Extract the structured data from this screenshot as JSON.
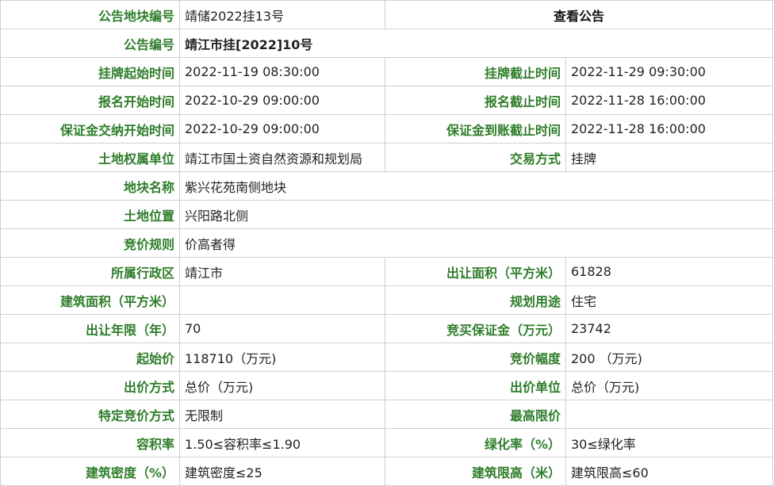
{
  "labels": {
    "block_no": "公告地块编号",
    "notice_no": "公告编号",
    "listing_start": "挂牌起始时间",
    "listing_end": "挂牌截止时间",
    "reg_start": "报名开始时间",
    "reg_end": "报名截止时间",
    "deposit_start": "保证金交纳开始时间",
    "deposit_end": "保证金到账截止时间",
    "owner": "土地权属单位",
    "trade_mode": "交易方式",
    "parcel_name": "地块名称",
    "location": "土地位置",
    "bid_rule": "竞价规则",
    "district": "所属行政区",
    "area": "出让面积（平方米）",
    "building_area": "建筑面积（平方米）",
    "usage": "规划用途",
    "term": "出让年限（年）",
    "bid_deposit": "竞买保证金（万元）",
    "start_price": "起始价",
    "increment": "竞价幅度",
    "bid_mode": "出价方式",
    "bid_unit": "出价单位",
    "special_mode": "特定竞价方式",
    "max_price": "最高限价",
    "far": "容积率",
    "green": "绿化率（%）",
    "density": "建筑密度（%）",
    "height": "建筑限高（米）"
  },
  "values": {
    "block_no": "靖储2022挂13号",
    "view_notice": "查看公告",
    "notice_no": "靖江市挂[2022]10号",
    "listing_start": "2022-11-19 08:30:00",
    "listing_end": "2022-11-29 09:30:00",
    "reg_start": "2022-10-29 09:00:00",
    "reg_end": "2022-11-28 16:00:00",
    "deposit_start": "2022-10-29 09:00:00",
    "deposit_end": "2022-11-28 16:00:00",
    "owner": "靖江市国土资自然资源和规划局",
    "trade_mode": "挂牌",
    "parcel_name": "紫兴花苑南侧地块",
    "location": "兴阳路北侧",
    "bid_rule": "价高者得",
    "district": "靖江市",
    "area": "61828",
    "building_area": "",
    "usage": "住宅",
    "term": "70",
    "bid_deposit": "23742",
    "start_price": "118710（万元)",
    "increment": "200 （万元)",
    "bid_mode": "总价（万元)",
    "bid_unit": "总价（万元)",
    "special_mode": "无限制",
    "max_price": "",
    "far": "1.50≤容积率≤1.90",
    "green": "30≤绿化率",
    "density": "建筑密度≤25",
    "height": "建筑限高≤60"
  },
  "colors": {
    "label_green": "#2e7d2a",
    "border": "#cfcfcf"
  }
}
